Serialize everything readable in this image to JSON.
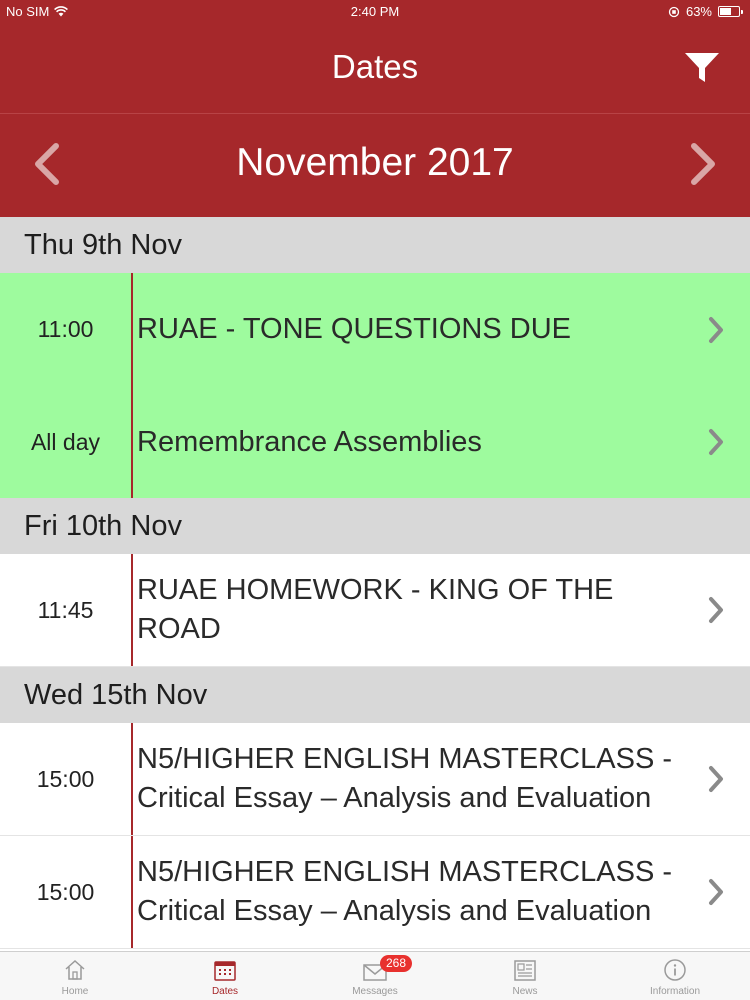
{
  "status": {
    "carrier": "No SIM",
    "time": "2:40 PM",
    "battery": "63%",
    "battery_level": 0.63
  },
  "header": {
    "title": "Dates",
    "month": "November 2017"
  },
  "days": [
    {
      "label": "Thu 9th Nov",
      "events": [
        {
          "time": "11:00",
          "title": "RUAE - TONE QUESTIONS DUE",
          "highlight": true
        },
        {
          "time": "All day",
          "title": "Remembrance Assemblies",
          "highlight": true
        }
      ]
    },
    {
      "label": "Fri 10th Nov",
      "events": [
        {
          "time": "11:45",
          "title": "RUAE HOMEWORK - KING OF THE ROAD",
          "highlight": false
        }
      ]
    },
    {
      "label": "Wed 15th Nov",
      "events": [
        {
          "time": "15:00",
          "title": "N5/HIGHER ENGLISH MASTERCLASS - Critical Essay – Analysis and Evaluation",
          "highlight": false
        },
        {
          "time": "15:00",
          "title": "N5/HIGHER ENGLISH MASTERCLASS - Critical Essay – Analysis and Evaluation",
          "highlight": false
        }
      ]
    }
  ],
  "tabs": [
    {
      "label": "Home",
      "icon": "home-icon"
    },
    {
      "label": "Dates",
      "icon": "calendar-icon",
      "active": true
    },
    {
      "label": "Messages",
      "icon": "envelope-icon",
      "badge": "268"
    },
    {
      "label": "News",
      "icon": "newspaper-icon"
    },
    {
      "label": "Information",
      "icon": "info-icon"
    }
  ],
  "colors": {
    "brand": "#a6282b",
    "highlight_row": "#9efb9e",
    "badge": "#e8312e"
  }
}
